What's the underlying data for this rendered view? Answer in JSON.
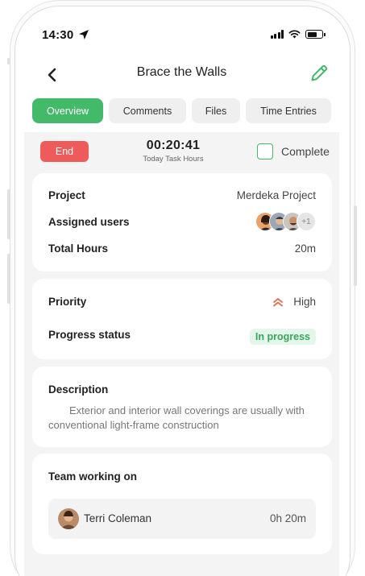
{
  "status_bar": {
    "time": "14:30"
  },
  "header": {
    "title": "Brace the Walls"
  },
  "tabs": [
    {
      "label": "Overview",
      "active": true
    },
    {
      "label": "Comments",
      "active": false
    },
    {
      "label": "Files",
      "active": false
    },
    {
      "label": "Time Entries",
      "active": false
    }
  ],
  "timer": {
    "end_label": "End",
    "value": "00:20:41",
    "subtitle": "Today Task Hours",
    "complete_label": "Complete",
    "complete_checked": false
  },
  "details": {
    "project_label": "Project",
    "project_value": "Merdeka Project",
    "assigned_label": "Assigned users",
    "assigned_more": "+1",
    "total_hours_label": "Total Hours",
    "total_hours_value": "20m"
  },
  "status": {
    "priority_label": "Priority",
    "priority_value": "High",
    "progress_label": "Progress status",
    "progress_value": "In progress"
  },
  "description": {
    "heading": "Description",
    "text": "Exterior and interior wall coverings are usually with conventional light-frame construction"
  },
  "team": {
    "heading": "Team working on",
    "members": [
      {
        "name": "Terri Coleman",
        "time": "0h 20m"
      }
    ]
  },
  "colors": {
    "accent": "#43b96a",
    "danger": "#ed5b5b",
    "priority_high": "#e0704f"
  }
}
